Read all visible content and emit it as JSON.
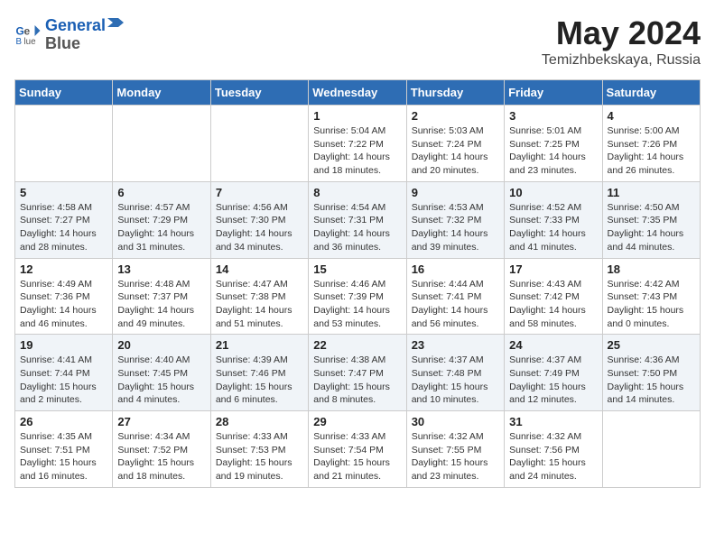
{
  "header": {
    "logo_line1": "General",
    "logo_line2": "Blue",
    "month_title": "May 2024",
    "location": "Temizhbekskaya, Russia"
  },
  "weekdays": [
    "Sunday",
    "Monday",
    "Tuesday",
    "Wednesday",
    "Thursday",
    "Friday",
    "Saturday"
  ],
  "weeks": [
    [
      {
        "day": "",
        "info": ""
      },
      {
        "day": "",
        "info": ""
      },
      {
        "day": "",
        "info": ""
      },
      {
        "day": "1",
        "info": "Sunrise: 5:04 AM\nSunset: 7:22 PM\nDaylight: 14 hours\nand 18 minutes."
      },
      {
        "day": "2",
        "info": "Sunrise: 5:03 AM\nSunset: 7:24 PM\nDaylight: 14 hours\nand 20 minutes."
      },
      {
        "day": "3",
        "info": "Sunrise: 5:01 AM\nSunset: 7:25 PM\nDaylight: 14 hours\nand 23 minutes."
      },
      {
        "day": "4",
        "info": "Sunrise: 5:00 AM\nSunset: 7:26 PM\nDaylight: 14 hours\nand 26 minutes."
      }
    ],
    [
      {
        "day": "5",
        "info": "Sunrise: 4:58 AM\nSunset: 7:27 PM\nDaylight: 14 hours\nand 28 minutes."
      },
      {
        "day": "6",
        "info": "Sunrise: 4:57 AM\nSunset: 7:29 PM\nDaylight: 14 hours\nand 31 minutes."
      },
      {
        "day": "7",
        "info": "Sunrise: 4:56 AM\nSunset: 7:30 PM\nDaylight: 14 hours\nand 34 minutes."
      },
      {
        "day": "8",
        "info": "Sunrise: 4:54 AM\nSunset: 7:31 PM\nDaylight: 14 hours\nand 36 minutes."
      },
      {
        "day": "9",
        "info": "Sunrise: 4:53 AM\nSunset: 7:32 PM\nDaylight: 14 hours\nand 39 minutes."
      },
      {
        "day": "10",
        "info": "Sunrise: 4:52 AM\nSunset: 7:33 PM\nDaylight: 14 hours\nand 41 minutes."
      },
      {
        "day": "11",
        "info": "Sunrise: 4:50 AM\nSunset: 7:35 PM\nDaylight: 14 hours\nand 44 minutes."
      }
    ],
    [
      {
        "day": "12",
        "info": "Sunrise: 4:49 AM\nSunset: 7:36 PM\nDaylight: 14 hours\nand 46 minutes."
      },
      {
        "day": "13",
        "info": "Sunrise: 4:48 AM\nSunset: 7:37 PM\nDaylight: 14 hours\nand 49 minutes."
      },
      {
        "day": "14",
        "info": "Sunrise: 4:47 AM\nSunset: 7:38 PM\nDaylight: 14 hours\nand 51 minutes."
      },
      {
        "day": "15",
        "info": "Sunrise: 4:46 AM\nSunset: 7:39 PM\nDaylight: 14 hours\nand 53 minutes."
      },
      {
        "day": "16",
        "info": "Sunrise: 4:44 AM\nSunset: 7:41 PM\nDaylight: 14 hours\nand 56 minutes."
      },
      {
        "day": "17",
        "info": "Sunrise: 4:43 AM\nSunset: 7:42 PM\nDaylight: 14 hours\nand 58 minutes."
      },
      {
        "day": "18",
        "info": "Sunrise: 4:42 AM\nSunset: 7:43 PM\nDaylight: 15 hours\nand 0 minutes."
      }
    ],
    [
      {
        "day": "19",
        "info": "Sunrise: 4:41 AM\nSunset: 7:44 PM\nDaylight: 15 hours\nand 2 minutes."
      },
      {
        "day": "20",
        "info": "Sunrise: 4:40 AM\nSunset: 7:45 PM\nDaylight: 15 hours\nand 4 minutes."
      },
      {
        "day": "21",
        "info": "Sunrise: 4:39 AM\nSunset: 7:46 PM\nDaylight: 15 hours\nand 6 minutes."
      },
      {
        "day": "22",
        "info": "Sunrise: 4:38 AM\nSunset: 7:47 PM\nDaylight: 15 hours\nand 8 minutes."
      },
      {
        "day": "23",
        "info": "Sunrise: 4:37 AM\nSunset: 7:48 PM\nDaylight: 15 hours\nand 10 minutes."
      },
      {
        "day": "24",
        "info": "Sunrise: 4:37 AM\nSunset: 7:49 PM\nDaylight: 15 hours\nand 12 minutes."
      },
      {
        "day": "25",
        "info": "Sunrise: 4:36 AM\nSunset: 7:50 PM\nDaylight: 15 hours\nand 14 minutes."
      }
    ],
    [
      {
        "day": "26",
        "info": "Sunrise: 4:35 AM\nSunset: 7:51 PM\nDaylight: 15 hours\nand 16 minutes."
      },
      {
        "day": "27",
        "info": "Sunrise: 4:34 AM\nSunset: 7:52 PM\nDaylight: 15 hours\nand 18 minutes."
      },
      {
        "day": "28",
        "info": "Sunrise: 4:33 AM\nSunset: 7:53 PM\nDaylight: 15 hours\nand 19 minutes."
      },
      {
        "day": "29",
        "info": "Sunrise: 4:33 AM\nSunset: 7:54 PM\nDaylight: 15 hours\nand 21 minutes."
      },
      {
        "day": "30",
        "info": "Sunrise: 4:32 AM\nSunset: 7:55 PM\nDaylight: 15 hours\nand 23 minutes."
      },
      {
        "day": "31",
        "info": "Sunrise: 4:32 AM\nSunset: 7:56 PM\nDaylight: 15 hours\nand 24 minutes."
      },
      {
        "day": "",
        "info": ""
      }
    ]
  ]
}
